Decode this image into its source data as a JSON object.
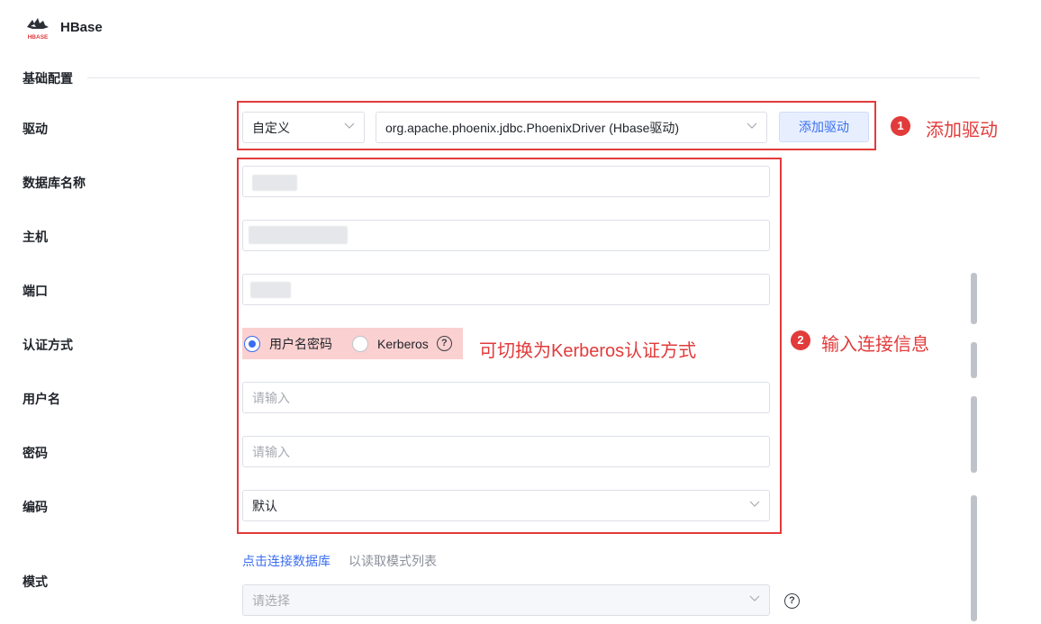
{
  "header": {
    "app_title": "HBase",
    "logo_text": "HBASE"
  },
  "section": {
    "title": "基础配置"
  },
  "fields": {
    "driver": {
      "label": "驱动",
      "type_value": "自定义",
      "driver_value": "org.apache.phoenix.jdbc.PhoenixDriver (Hbase驱动)",
      "add_button": "添加驱动"
    },
    "database_name": {
      "label": "数据库名称"
    },
    "host": {
      "label": "主机"
    },
    "port": {
      "label": "端口"
    },
    "auth": {
      "label": "认证方式",
      "option_password": "用户名密码",
      "option_kerberos": "Kerberos",
      "selected": "用户名密码"
    },
    "username": {
      "label": "用户名",
      "placeholder": "请输入"
    },
    "password": {
      "label": "密码",
      "placeholder": "请输入"
    },
    "encoding": {
      "label": "编码",
      "value": "默认"
    },
    "schema": {
      "label": "模式",
      "link": "点击连接数据库",
      "hint": "以读取模式列表",
      "placeholder": "请选择"
    }
  },
  "annotations": {
    "step1": {
      "number": "1",
      "text": "添加驱动"
    },
    "step2": {
      "number": "2",
      "text": "输入连接信息"
    },
    "kerberos_note": "可切换为Kerberos认证方式"
  },
  "colors": {
    "accent": "#3a6df0",
    "annotation_red": "#e23b3b",
    "highlight_pink": "#fbd0d0"
  }
}
